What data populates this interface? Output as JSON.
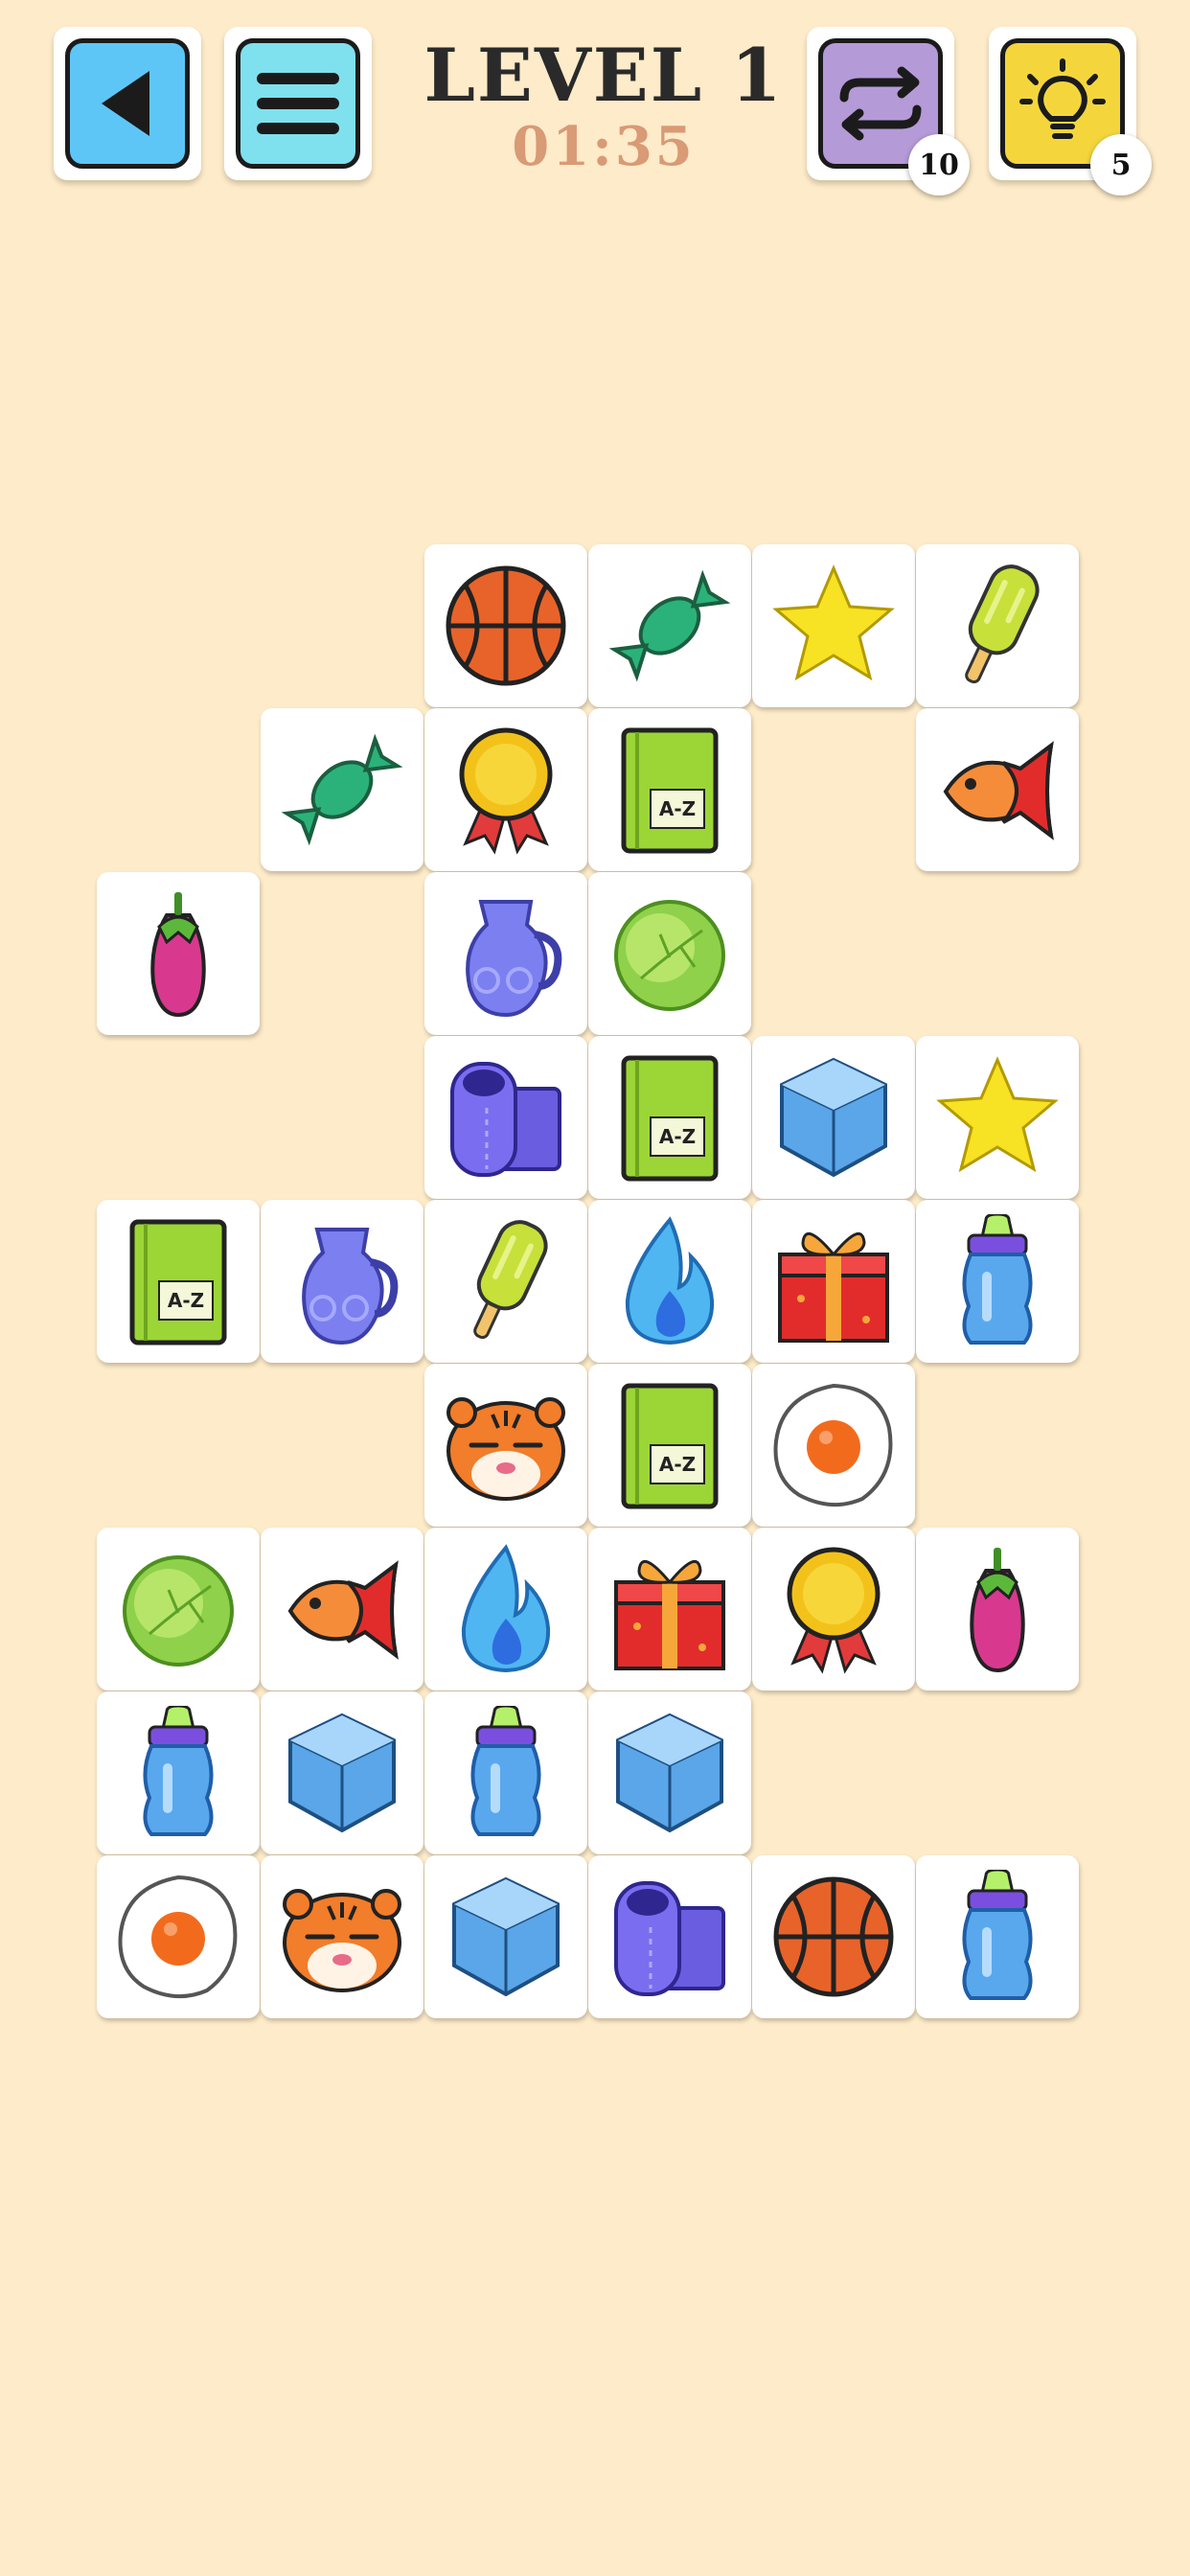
{
  "header": {
    "title": "LEVEL 1",
    "timer": "01:35",
    "back_button": {
      "icon": "back-arrow-icon",
      "color": "#5ec6f6"
    },
    "menu_button": {
      "icon": "menu-icon",
      "color": "#7fe0ee"
    },
    "shuffle_button": {
      "icon": "shuffle-icon",
      "color": "#b59ad8",
      "count": "10"
    },
    "hint_button": {
      "icon": "lightbulb-icon",
      "color": "#f4d63c",
      "count": "5"
    }
  },
  "board": {
    "rows": [
      [
        null,
        null,
        "basketball",
        "candy",
        "star",
        "popsicle"
      ],
      [
        null,
        "candy",
        "medal",
        "book",
        null,
        "fish"
      ],
      [
        "eggplant",
        null,
        "jug",
        "lettuce",
        null,
        null
      ],
      [
        null,
        null,
        "toilet-paper",
        "book",
        "ice-cube",
        "star"
      ],
      [
        "book",
        "jug",
        "popsicle",
        "fire",
        "gift",
        "baby-bottle"
      ],
      [
        null,
        null,
        "tiger",
        "book",
        "fried-egg",
        null
      ],
      [
        "lettuce",
        "fish",
        "fire",
        "gift",
        "medal",
        "eggplant"
      ],
      [
        "baby-bottle",
        "ice-cube",
        "baby-bottle",
        "ice-cube",
        null,
        null
      ],
      [
        "fried-egg",
        "tiger",
        "ice-cube",
        "toilet-paper",
        "basketball",
        "baby-bottle"
      ]
    ]
  },
  "book_label": "A-Z"
}
